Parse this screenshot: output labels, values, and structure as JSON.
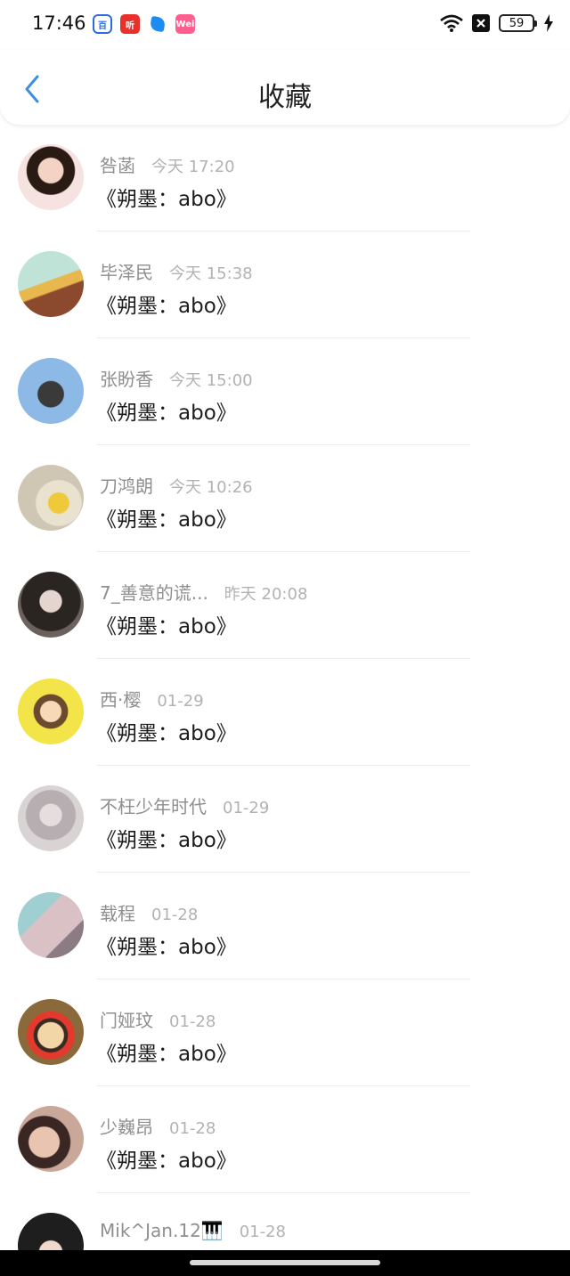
{
  "status_bar": {
    "time": "17:46",
    "battery": "59",
    "notification_icons": [
      {
        "name": "baidu-app-icon",
        "text": "百"
      },
      {
        "name": "ting-app-icon",
        "text": "听"
      },
      {
        "name": "blue-app-icon",
        "text": ""
      },
      {
        "name": "weiwei-app-icon",
        "text": "Wei"
      }
    ],
    "colors": {
      "baidu": "#2d6be4",
      "ting": "#e8312a",
      "blue": "#1c8cf2",
      "weiwei": "#ff5f8f"
    }
  },
  "header": {
    "title": "收藏",
    "back_icon": "chevron-left-icon",
    "accent": "#3d8fe0"
  },
  "items": [
    {
      "name": "咎菡",
      "time": "今天 17:20",
      "content": "《朔墨：abo》"
    },
    {
      "name": "毕泽民",
      "time": "今天 15:38",
      "content": "《朔墨：abo》"
    },
    {
      "name": "张盼香",
      "time": "今天 15:00",
      "content": "《朔墨：abo》"
    },
    {
      "name": "刀鸿朗",
      "time": "今天 10:26",
      "content": "《朔墨：abo》"
    },
    {
      "name": "7_善意的谎...",
      "time": "昨天 20:08",
      "content": "《朔墨：abo》"
    },
    {
      "name": "西·樱",
      "time": "01-29",
      "content": "《朔墨：abo》"
    },
    {
      "name": "不枉少年时代",
      "time": "01-29",
      "content": "《朔墨：abo》"
    },
    {
      "name": "载程",
      "time": "01-28",
      "content": "《朔墨：abo》"
    },
    {
      "name": "门娅玟",
      "time": "01-28",
      "content": "《朔墨：abo》"
    },
    {
      "name": "少巍昂",
      "time": "01-28",
      "content": "《朔墨：abo》"
    },
    {
      "name": "Mik^Jan.12🎹",
      "time": "01-28",
      "content": ""
    }
  ]
}
